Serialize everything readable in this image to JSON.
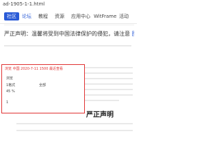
{
  "address_bar": {
    "url": "ad-1905-1-1.html"
  },
  "nav": {
    "items": [
      {
        "label": "社区",
        "active": true
      },
      {
        "label": "论坛",
        "active": false,
        "highlight": true
      },
      {
        "label": "教程",
        "active": false
      },
      {
        "label": "资源",
        "active": false
      },
      {
        "label": "应用中心",
        "active": false
      },
      {
        "label": "WitFrame",
        "active": false
      },
      {
        "label": "活动",
        "active": false
      }
    ]
  },
  "article": {
    "title": "严正声明：温馨将受到中国法律保护的侵犯，请注意",
    "title_suffix": "图"
  },
  "popup": {
    "header": "浏览 中国 2020-7-11 1500 最近查看",
    "items": [
      "浏览",
      "1格式",
      "45 %",
      "全部",
      "1"
    ]
  },
  "section": {
    "title": "严正声明"
  },
  "colors": {
    "accent": "#2a5bd7",
    "popup_border": "#e03030"
  }
}
